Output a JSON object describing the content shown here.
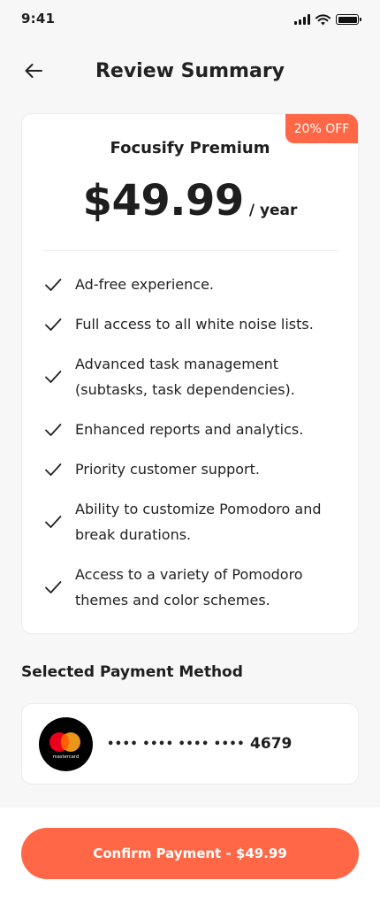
{
  "status_bar": {
    "time": "9:41"
  },
  "header": {
    "title": "Review Summary",
    "back_icon": "arrow-left-icon"
  },
  "plan": {
    "badge": "20% OFF",
    "name": "Focusify Premium",
    "price": "$49.99",
    "period": "/ year",
    "features": [
      "Ad-free experience.",
      "Full access to all white noise lists.",
      "Advanced task management (subtasks, task dependencies).",
      "Enhanced reports and analytics.",
      "Priority customer support.",
      "Ability to customize Pomodoro and break durations.",
      "Access to a variety of Pomodoro themes and color schemes."
    ]
  },
  "payment": {
    "section_label": "Selected Payment Method",
    "brand": "mastercard",
    "masked": "•••• •••• •••• ••••",
    "last4": "4679"
  },
  "footer": {
    "confirm_label": "Confirm Payment - $49.99"
  },
  "colors": {
    "accent": "#ff6746",
    "background": "#f7f7f7",
    "text": "#1e1e1e"
  }
}
